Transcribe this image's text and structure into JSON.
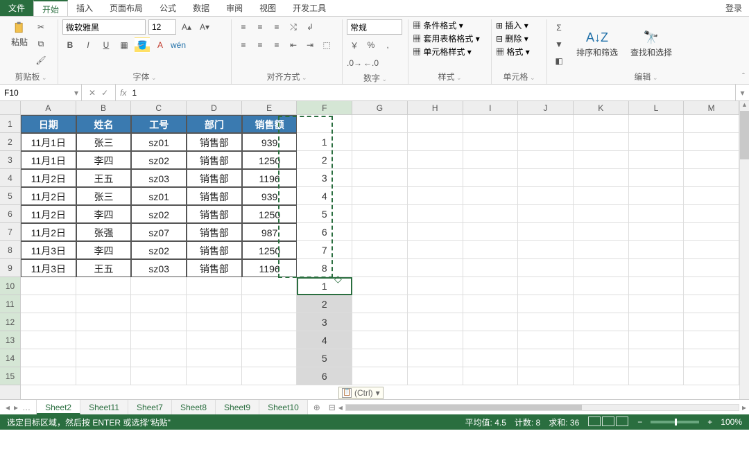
{
  "tabs": {
    "file": "文件",
    "home": "开始",
    "insert": "插入",
    "layout": "页面布局",
    "formulas": "公式",
    "data": "数据",
    "review": "审阅",
    "view": "视图",
    "dev": "开发工具",
    "login": "登录"
  },
  "ribbon": {
    "clipboard": {
      "label": "剪贴板",
      "paste": "粘贴"
    },
    "font": {
      "label": "字体",
      "name": "微软雅黑",
      "size": "12",
      "bold": "B",
      "italic": "I",
      "underline": "U"
    },
    "align": {
      "label": "对齐方式"
    },
    "number": {
      "label": "数字",
      "format": "常规"
    },
    "styles": {
      "label": "样式",
      "cond": "条件格式",
      "table": "套用表格格式",
      "cell": "单元格样式"
    },
    "cells": {
      "label": "单元格",
      "insert": "插入",
      "delete": "删除",
      "format": "格式"
    },
    "editing": {
      "label": "编辑",
      "sort": "排序和筛选",
      "find": "查找和选择"
    }
  },
  "namebox": "F10",
  "formula_value": "1",
  "columns": [
    "A",
    "B",
    "C",
    "D",
    "E",
    "F",
    "G",
    "H",
    "I",
    "J",
    "K",
    "L",
    "M"
  ],
  "rows": [
    "1",
    "2",
    "3",
    "4",
    "5",
    "6",
    "7",
    "8",
    "9",
    "10",
    "11",
    "12",
    "13",
    "14",
    "15"
  ],
  "headers": [
    "日期",
    "姓名",
    "工号",
    "部门",
    "销售额"
  ],
  "data": [
    [
      "11月1日",
      "张三",
      "sz01",
      "销售部",
      "939"
    ],
    [
      "11月1日",
      "李四",
      "sz02",
      "销售部",
      "1250"
    ],
    [
      "11月2日",
      "王五",
      "sz03",
      "销售部",
      "1196"
    ],
    [
      "11月2日",
      "张三",
      "sz01",
      "销售部",
      "939"
    ],
    [
      "11月2日",
      "李四",
      "sz02",
      "销售部",
      "1250"
    ],
    [
      "11月2日",
      "张强",
      "sz07",
      "销售部",
      "987"
    ],
    [
      "11月3日",
      "李四",
      "sz02",
      "销售部",
      "1250"
    ],
    [
      "11月3日",
      "王五",
      "sz03",
      "销售部",
      "1196"
    ]
  ],
  "fcol": [
    "1",
    "2",
    "3",
    "4",
    "5",
    "6",
    "7",
    "8",
    "1",
    "2",
    "3",
    "4",
    "5",
    "6"
  ],
  "pasteopt": "(Ctrl)",
  "sheets": {
    "list": [
      "Sheet2",
      "Sheet11",
      "Sheet7",
      "Sheet8",
      "Sheet9",
      "Sheet10"
    ],
    "active": "Sheet2"
  },
  "status": {
    "msg": "选定目标区域，然后按 ENTER 或选择\"粘贴\"",
    "avg": "平均值: 4.5",
    "count": "计数: 8",
    "sum": "求和: 36",
    "zoom": "100%"
  }
}
